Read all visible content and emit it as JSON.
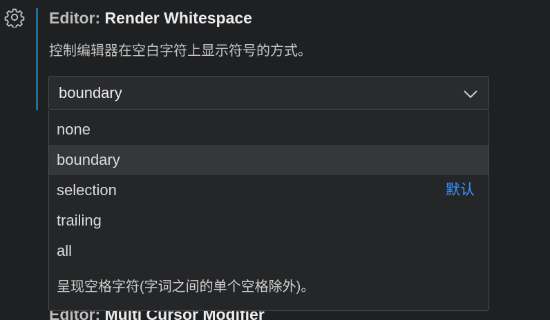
{
  "setting": {
    "category": "Editor:",
    "name": "Render Whitespace",
    "description": "控制编辑器在空白字符上显示符号的方式。"
  },
  "select": {
    "value": "boundary",
    "icon": "chevron-down-icon"
  },
  "dropdown": {
    "options": [
      {
        "label": "none",
        "selected": false
      },
      {
        "label": "boundary",
        "selected": true
      },
      {
        "label": "selection",
        "selected": false,
        "default_label": "默认"
      },
      {
        "label": "trailing",
        "selected": false
      },
      {
        "label": "all",
        "selected": false
      }
    ],
    "selected_description": "呈现空格字符(字词之间的单个空格除外)。"
  },
  "next_setting": {
    "category": "Editor:",
    "name": "Multi Cursor Modifier"
  },
  "icons": {
    "settings": "gear-icon"
  },
  "colors": {
    "background": "#1f2022",
    "accent_bar": "#1e6fa0",
    "default_badge": "#3794ff",
    "selected_row": "#36373b"
  }
}
